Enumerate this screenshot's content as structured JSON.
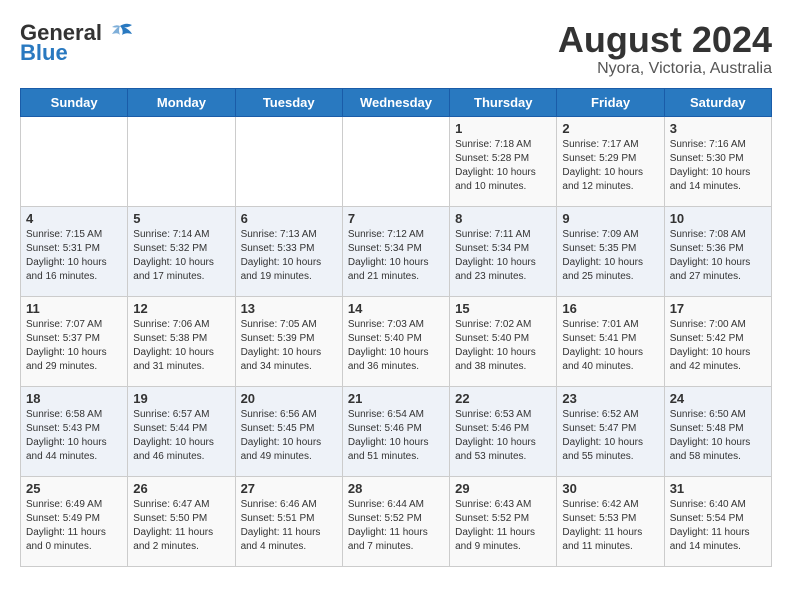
{
  "header": {
    "logo_general": "General",
    "logo_blue": "Blue",
    "title": "August 2024",
    "subtitle": "Nyora, Victoria, Australia"
  },
  "weekdays": [
    "Sunday",
    "Monday",
    "Tuesday",
    "Wednesday",
    "Thursday",
    "Friday",
    "Saturday"
  ],
  "weeks": [
    [
      {
        "day": "",
        "info": ""
      },
      {
        "day": "",
        "info": ""
      },
      {
        "day": "",
        "info": ""
      },
      {
        "day": "",
        "info": ""
      },
      {
        "day": "1",
        "info": "Sunrise: 7:18 AM\nSunset: 5:28 PM\nDaylight: 10 hours\nand 10 minutes."
      },
      {
        "day": "2",
        "info": "Sunrise: 7:17 AM\nSunset: 5:29 PM\nDaylight: 10 hours\nand 12 minutes."
      },
      {
        "day": "3",
        "info": "Sunrise: 7:16 AM\nSunset: 5:30 PM\nDaylight: 10 hours\nand 14 minutes."
      }
    ],
    [
      {
        "day": "4",
        "info": "Sunrise: 7:15 AM\nSunset: 5:31 PM\nDaylight: 10 hours\nand 16 minutes."
      },
      {
        "day": "5",
        "info": "Sunrise: 7:14 AM\nSunset: 5:32 PM\nDaylight: 10 hours\nand 17 minutes."
      },
      {
        "day": "6",
        "info": "Sunrise: 7:13 AM\nSunset: 5:33 PM\nDaylight: 10 hours\nand 19 minutes."
      },
      {
        "day": "7",
        "info": "Sunrise: 7:12 AM\nSunset: 5:34 PM\nDaylight: 10 hours\nand 21 minutes."
      },
      {
        "day": "8",
        "info": "Sunrise: 7:11 AM\nSunset: 5:34 PM\nDaylight: 10 hours\nand 23 minutes."
      },
      {
        "day": "9",
        "info": "Sunrise: 7:09 AM\nSunset: 5:35 PM\nDaylight: 10 hours\nand 25 minutes."
      },
      {
        "day": "10",
        "info": "Sunrise: 7:08 AM\nSunset: 5:36 PM\nDaylight: 10 hours\nand 27 minutes."
      }
    ],
    [
      {
        "day": "11",
        "info": "Sunrise: 7:07 AM\nSunset: 5:37 PM\nDaylight: 10 hours\nand 29 minutes."
      },
      {
        "day": "12",
        "info": "Sunrise: 7:06 AM\nSunset: 5:38 PM\nDaylight: 10 hours\nand 31 minutes."
      },
      {
        "day": "13",
        "info": "Sunrise: 7:05 AM\nSunset: 5:39 PM\nDaylight: 10 hours\nand 34 minutes."
      },
      {
        "day": "14",
        "info": "Sunrise: 7:03 AM\nSunset: 5:40 PM\nDaylight: 10 hours\nand 36 minutes."
      },
      {
        "day": "15",
        "info": "Sunrise: 7:02 AM\nSunset: 5:40 PM\nDaylight: 10 hours\nand 38 minutes."
      },
      {
        "day": "16",
        "info": "Sunrise: 7:01 AM\nSunset: 5:41 PM\nDaylight: 10 hours\nand 40 minutes."
      },
      {
        "day": "17",
        "info": "Sunrise: 7:00 AM\nSunset: 5:42 PM\nDaylight: 10 hours\nand 42 minutes."
      }
    ],
    [
      {
        "day": "18",
        "info": "Sunrise: 6:58 AM\nSunset: 5:43 PM\nDaylight: 10 hours\nand 44 minutes."
      },
      {
        "day": "19",
        "info": "Sunrise: 6:57 AM\nSunset: 5:44 PM\nDaylight: 10 hours\nand 46 minutes."
      },
      {
        "day": "20",
        "info": "Sunrise: 6:56 AM\nSunset: 5:45 PM\nDaylight: 10 hours\nand 49 minutes."
      },
      {
        "day": "21",
        "info": "Sunrise: 6:54 AM\nSunset: 5:46 PM\nDaylight: 10 hours\nand 51 minutes."
      },
      {
        "day": "22",
        "info": "Sunrise: 6:53 AM\nSunset: 5:46 PM\nDaylight: 10 hours\nand 53 minutes."
      },
      {
        "day": "23",
        "info": "Sunrise: 6:52 AM\nSunset: 5:47 PM\nDaylight: 10 hours\nand 55 minutes."
      },
      {
        "day": "24",
        "info": "Sunrise: 6:50 AM\nSunset: 5:48 PM\nDaylight: 10 hours\nand 58 minutes."
      }
    ],
    [
      {
        "day": "25",
        "info": "Sunrise: 6:49 AM\nSunset: 5:49 PM\nDaylight: 11 hours\nand 0 minutes."
      },
      {
        "day": "26",
        "info": "Sunrise: 6:47 AM\nSunset: 5:50 PM\nDaylight: 11 hours\nand 2 minutes."
      },
      {
        "day": "27",
        "info": "Sunrise: 6:46 AM\nSunset: 5:51 PM\nDaylight: 11 hours\nand 4 minutes."
      },
      {
        "day": "28",
        "info": "Sunrise: 6:44 AM\nSunset: 5:52 PM\nDaylight: 11 hours\nand 7 minutes."
      },
      {
        "day": "29",
        "info": "Sunrise: 6:43 AM\nSunset: 5:52 PM\nDaylight: 11 hours\nand 9 minutes."
      },
      {
        "day": "30",
        "info": "Sunrise: 6:42 AM\nSunset: 5:53 PM\nDaylight: 11 hours\nand 11 minutes."
      },
      {
        "day": "31",
        "info": "Sunrise: 6:40 AM\nSunset: 5:54 PM\nDaylight: 11 hours\nand 14 minutes."
      }
    ]
  ]
}
